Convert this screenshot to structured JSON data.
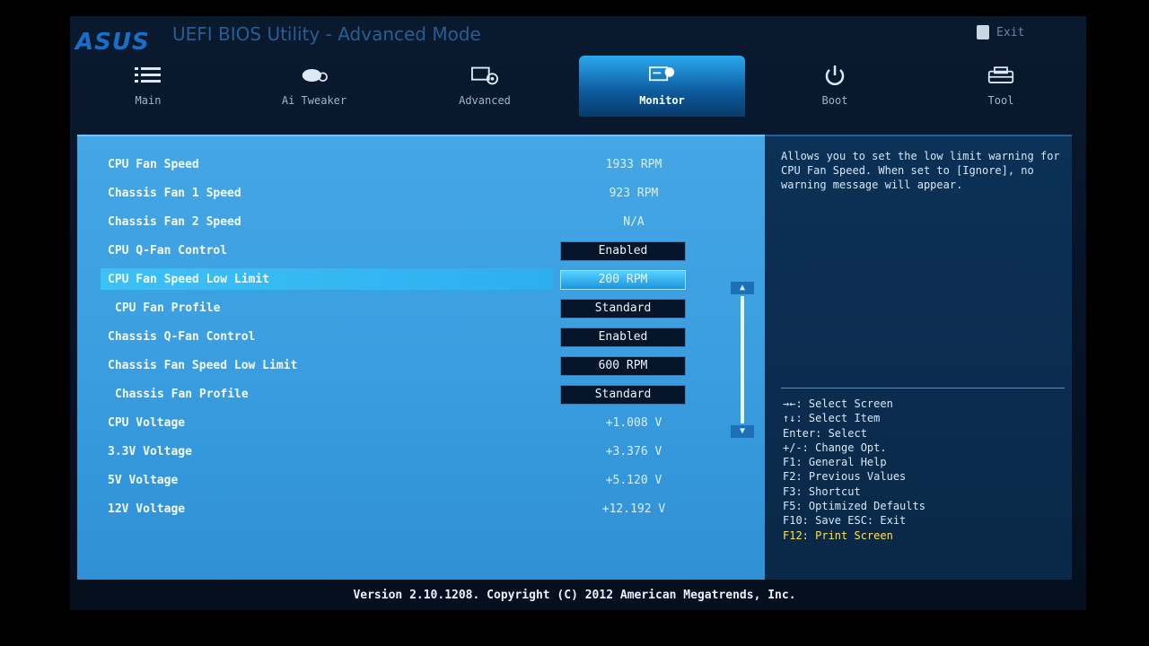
{
  "header": {
    "brand": "ASUS",
    "title": "UEFI BIOS Utility - Advanced Mode",
    "exit_label": "Exit"
  },
  "tabs": [
    {
      "label": "Main",
      "icon": "list-icon"
    },
    {
      "label": "Ai Tweaker",
      "icon": "tweaker-icon"
    },
    {
      "label": "Advanced",
      "icon": "advanced-icon"
    },
    {
      "label": "Monitor",
      "icon": "monitor-icon",
      "active": true
    },
    {
      "label": "Boot",
      "icon": "power-icon"
    },
    {
      "label": "Tool",
      "icon": "tool-icon"
    }
  ],
  "settings": [
    {
      "label": "CPU Fan Speed",
      "value": "1933 RPM",
      "type": "text"
    },
    {
      "label": "Chassis Fan 1 Speed",
      "value": "923 RPM",
      "type": "text"
    },
    {
      "label": "Chassis Fan 2 Speed",
      "value": "N/A",
      "type": "text"
    },
    {
      "label": "CPU Q-Fan Control",
      "value": "Enabled",
      "type": "option"
    },
    {
      "label": "CPU Fan Speed Low Limit",
      "value": "200 RPM",
      "type": "option",
      "selected": true
    },
    {
      "label": "CPU Fan Profile",
      "value": "Standard",
      "type": "option"
    },
    {
      "label": "Chassis Q-Fan Control",
      "value": "Enabled",
      "type": "option"
    },
    {
      "label": "Chassis Fan Speed Low Limit",
      "value": "600 RPM",
      "type": "option"
    },
    {
      "label": "Chassis Fan Profile",
      "value": "Standard",
      "type": "option"
    },
    {
      "label": "CPU Voltage",
      "value": "+1.008 V",
      "type": "text"
    },
    {
      "label": "3.3V Voltage",
      "value": "+3.376 V",
      "type": "text"
    },
    {
      "label": "5V Voltage",
      "value": "+5.120 V",
      "type": "text"
    },
    {
      "label": "12V Voltage",
      "value": "+12.192 V",
      "type": "text"
    }
  ],
  "help": {
    "description": "Allows you to set the low limit warning for CPU Fan Speed. When set to [Ignore], no warning message will appear.",
    "keys": [
      "→←: Select Screen",
      "↑↓: Select Item",
      "Enter: Select",
      "+/-: Change Opt.",
      "F1: General Help",
      "F2: Previous Values",
      "F3: Shortcut",
      "F5: Optimized Defaults",
      "F10: Save  ESC: Exit",
      "F12: Print Screen"
    ]
  },
  "footer": "Version 2.10.1208. Copyright (C) 2012 American Megatrends, Inc.",
  "colors": {
    "panel": "#3a9ee0",
    "selected_row": "#2dafef",
    "help_bg": "#0b2c4f",
    "highlight_key": "#ffe24a"
  }
}
